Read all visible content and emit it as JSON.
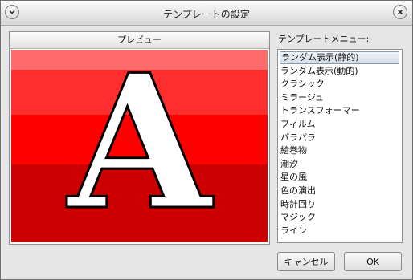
{
  "window": {
    "title": "テンプレートの設定"
  },
  "preview": {
    "header": "プレビュー",
    "letter": "A"
  },
  "template_menu": {
    "label": "テンプレートメニュー:",
    "items": [
      {
        "label": "ランダム表示(静的)",
        "selected": true
      },
      {
        "label": "ランダム表示(動的)",
        "selected": false
      },
      {
        "label": "クラシック",
        "selected": false
      },
      {
        "label": "ミラージュ",
        "selected": false
      },
      {
        "label": "トランスフォーマー",
        "selected": false
      },
      {
        "label": "フィルム",
        "selected": false
      },
      {
        "label": "パラパラ",
        "selected": false
      },
      {
        "label": "絵巻物",
        "selected": false
      },
      {
        "label": "潮汐",
        "selected": false
      },
      {
        "label": "星の風",
        "selected": false
      },
      {
        "label": "色の演出",
        "selected": false
      },
      {
        "label": "時計回り",
        "selected": false
      },
      {
        "label": "マジック",
        "selected": false
      },
      {
        "label": "ライン",
        "selected": false
      }
    ]
  },
  "buttons": {
    "cancel": "キャンセル",
    "ok": "OK"
  },
  "colors": {
    "stripe1": "#ff6a6a",
    "stripe2": "#ff2e2e",
    "stripe3": "#ff0000",
    "stripe4": "#cc0000",
    "letter_fill": "#ffffff",
    "letter_stroke": "#000000"
  }
}
